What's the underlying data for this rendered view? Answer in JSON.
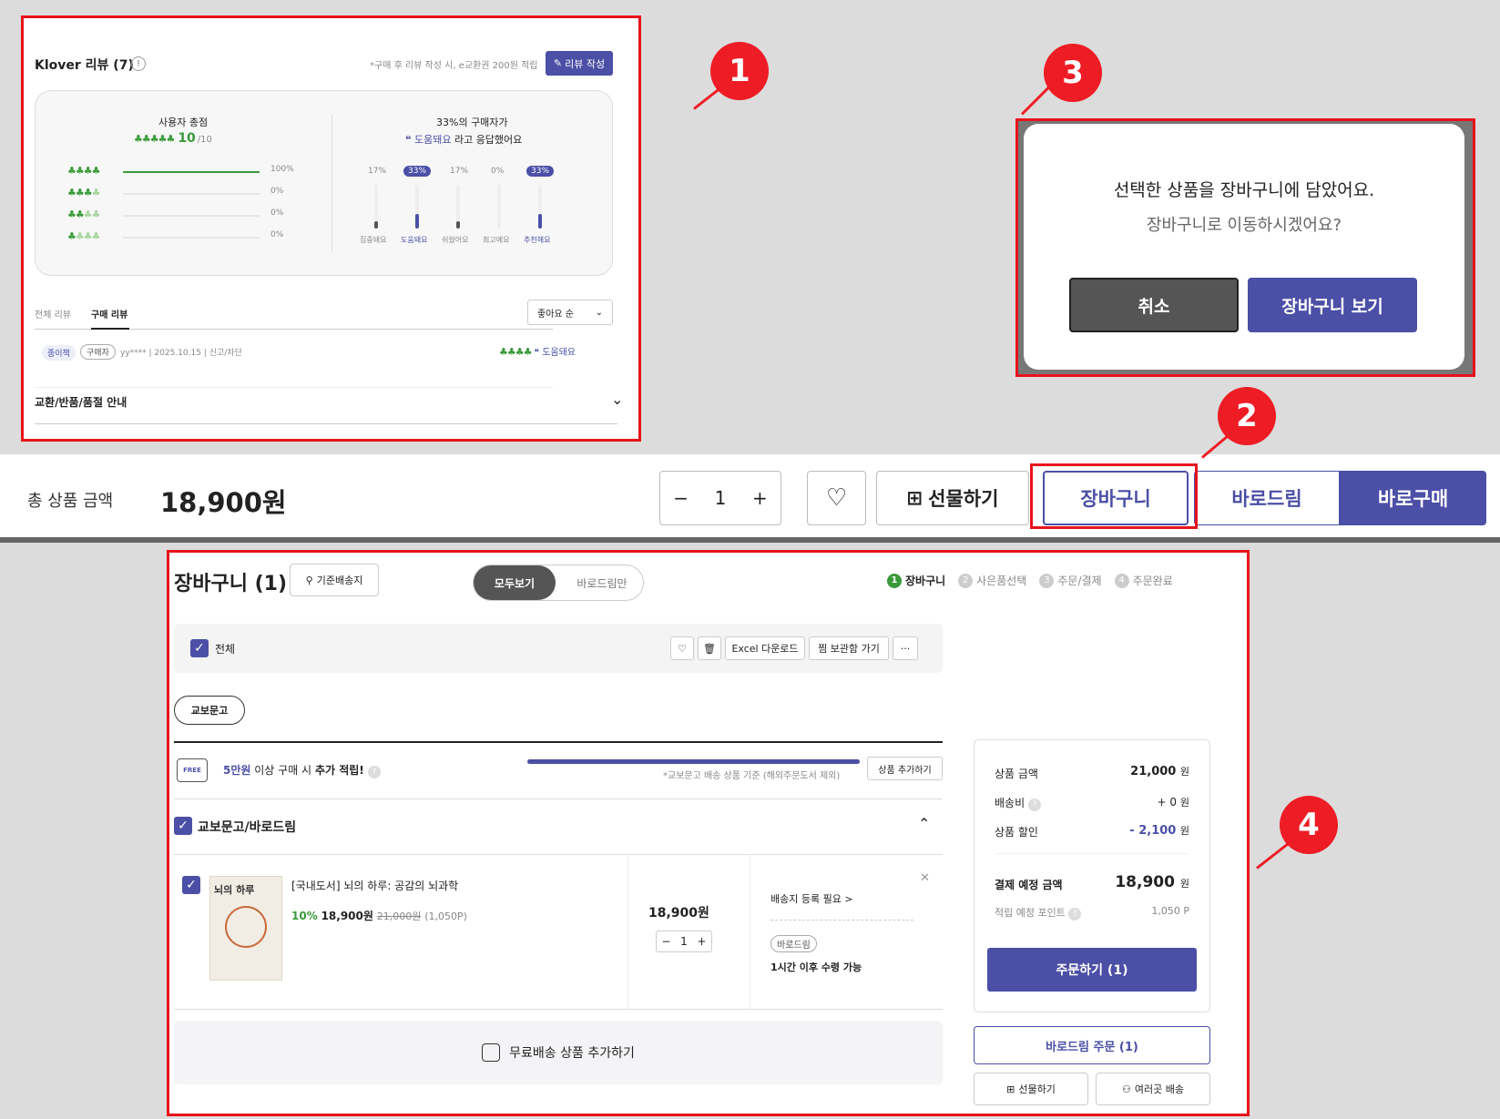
{
  "panel1": {
    "title": "Klover 리뷰 (7)",
    "info_icon": "info-icon",
    "notice": "*구매 후 리뷰 작성 시, e교환권 200원 적립",
    "write_button": "리뷰 작성",
    "summary": {
      "score_label": "사용자 총점",
      "score_value": "10",
      "score_max": "/10",
      "score_rows": [
        {
          "pct": "100%",
          "value": 1.0
        },
        {
          "pct": "0%",
          "value": 0
        },
        {
          "pct": "0%",
          "value": 0
        },
        {
          "pct": "0%",
          "value": 0
        }
      ],
      "survey_title": "33%의 구매자가",
      "survey_answer_keyword": "도움돼요",
      "survey_answer_rest": "라고 응답했어요",
      "survey_items": [
        {
          "pct": "17%",
          "label": "집중돼요",
          "value": 0.17,
          "highlight": false
        },
        {
          "pct": "33%",
          "label": "도움돼요",
          "value": 0.33,
          "highlight": true
        },
        {
          "pct": "17%",
          "label": "쉬웠어요",
          "value": 0.17,
          "highlight": false
        },
        {
          "pct": "0%",
          "label": "최고예요",
          "value": 0,
          "highlight": false
        },
        {
          "pct": "33%",
          "label": "추천해요",
          "value": 0.33,
          "highlight": true
        }
      ]
    },
    "tabs": {
      "all": "전체 리뷰",
      "purchase": "구매 리뷰"
    },
    "sort_select": "좋아요 순",
    "review": {
      "tag1": "종이책",
      "tag2": "구매자",
      "meta": "yy**** | 2025.10.15 | 신고/차단",
      "answer": "도움돼요"
    },
    "accordion": "교환/반품/품절 안내"
  },
  "badges": {
    "b1": "1",
    "b2": "2",
    "b3": "3",
    "b4": "4"
  },
  "bottom_bar": {
    "total_label": "총 상품 금액",
    "total_value": "18,900원",
    "qty": "1",
    "gift_button": "선물하기",
    "cart_button": "장바구니",
    "barodrim_button": "바로드림",
    "buy_button": "바로구매"
  },
  "dialog": {
    "message": "선택한 상품을 장바구니에 담았어요.",
    "question": "장바구니로 이동하시겠어요?",
    "cancel": "취소",
    "confirm": "장바구니 보기"
  },
  "cart": {
    "title": "장바구니 (1)",
    "delivery_button": "기준배송지",
    "toggle_all": "모두보기",
    "toggle_baro": "바로드림만",
    "steps": [
      {
        "num": "1",
        "label": "장바구니",
        "active": true
      },
      {
        "num": "2",
        "label": "사은품선택",
        "active": false
      },
      {
        "num": "3",
        "label": "주문/결제",
        "active": false
      },
      {
        "num": "4",
        "label": "주문완료",
        "active": false
      }
    ],
    "select_all": "전체",
    "excel_button": "Excel 다운로드",
    "wishlist_button": "찜 보관함 가기",
    "more_button": "···",
    "store_chip": "교보문고",
    "free_ship": {
      "amount": "5만원",
      "text1": "이상 구매 시",
      "text2": "추가 적립!",
      "note": "*교보문고 배송 상품 기준 (해외주문도서 제외)",
      "add_button": "상품 추가하기",
      "free_label": "FREE",
      "progress": 1.0
    },
    "group_title": "교보문고/바로드림",
    "item": {
      "name": "[국내도서] 뇌의 하루: 공감의 뇌과학",
      "discount": "10%",
      "price": "18,900원",
      "orig_price": "21,000원",
      "points": "(1,050P)",
      "cover_title": "뇌의 하루",
      "subtotal": "18,900원",
      "qty": "1",
      "ship_link": "배송지 등록 필요 >",
      "baro_tag": "바로드림",
      "pickup": "1시간 이후 수령 가능"
    },
    "add_free": "무료배송 상품 추가하기",
    "summary": {
      "product_label": "상품 금액",
      "product_value": "21,000",
      "ship_label": "배송비",
      "ship_value": "+ 0",
      "discount_label": "상품 할인",
      "discount_value": "- 2,100",
      "won": "원",
      "total_label": "결제 예정 금액",
      "total_value": "18,900",
      "point_label": "적립 예정 포인트",
      "point_value": "1,050 P",
      "order_button": "주문하기 (1)",
      "baro_order": "바로드림 주문 (1)",
      "gift": "선물하기",
      "multi": "여러곳 배송"
    }
  }
}
